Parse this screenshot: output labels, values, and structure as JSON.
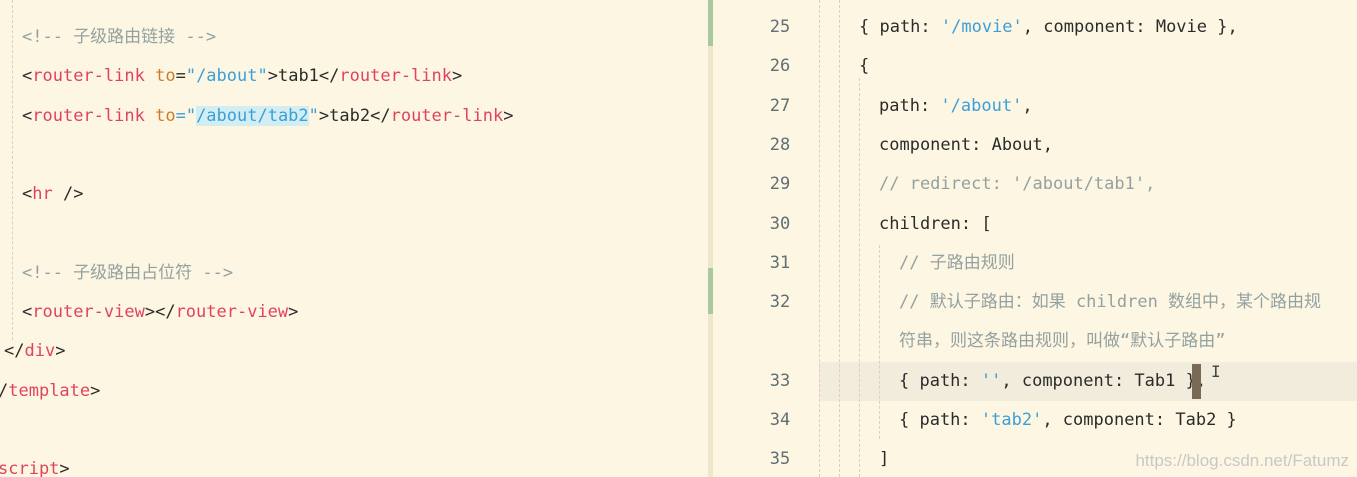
{
  "left_editor": {
    "lines": [
      [
        {
          "t": "<!-- 子级路由链接 -->",
          "c": "cmt"
        }
      ],
      [
        {
          "t": "<",
          "c": "pun"
        },
        {
          "t": "router-link",
          "c": "tag"
        },
        {
          "t": " ",
          "c": "pun"
        },
        {
          "t": "to",
          "c": "attr"
        },
        {
          "t": "=",
          "c": "pun"
        },
        {
          "t": "\"/about\"",
          "c": "str"
        },
        {
          "t": ">",
          "c": "pun"
        },
        {
          "t": "tab1",
          "c": "txt"
        },
        {
          "t": "</",
          "c": "pun"
        },
        {
          "t": "router-link",
          "c": "tag"
        },
        {
          "t": ">",
          "c": "pun"
        }
      ],
      [
        {
          "t": "<",
          "c": "pun"
        },
        {
          "t": "router-link",
          "c": "tag"
        },
        {
          "t": " ",
          "c": "pun"
        },
        {
          "t": "to",
          "c": "attr"
        },
        {
          "t": "=\"",
          "c": "str"
        },
        {
          "t": "/about/tab2",
          "c": "str",
          "hl": true
        },
        {
          "t": "\"",
          "c": "str"
        },
        {
          "t": ">",
          "c": "pun"
        },
        {
          "t": "tab2",
          "c": "txt"
        },
        {
          "t": "</",
          "c": "pun"
        },
        {
          "t": "router-link",
          "c": "tag"
        },
        {
          "t": ">",
          "c": "pun"
        }
      ],
      [],
      [
        {
          "t": "<",
          "c": "pun"
        },
        {
          "t": "hr",
          "c": "tag"
        },
        {
          "t": " />",
          "c": "pun"
        }
      ],
      [],
      [
        {
          "t": "<!-- 子级路由占位符 -->",
          "c": "cmt"
        }
      ],
      [
        {
          "t": "<",
          "c": "pun"
        },
        {
          "t": "router-view",
          "c": "tag"
        },
        {
          "t": "></",
          "c": "pun"
        },
        {
          "t": "router-view",
          "c": "tag"
        },
        {
          "t": ">",
          "c": "pun"
        }
      ],
      [
        {
          "t": "</",
          "c": "pun"
        },
        {
          "t": "div",
          "c": "tag"
        },
        {
          "t": ">",
          "c": "pun"
        }
      ],
      [
        {
          "t": "/",
          "c": "pun"
        },
        {
          "t": "template",
          "c": "tag"
        },
        {
          "t": ">",
          "c": "pun"
        }
      ],
      [],
      [
        {
          "t": "script",
          "c": "tag"
        },
        {
          "t": ">",
          "c": "pun"
        }
      ]
    ]
  },
  "right_editor": {
    "lines": [
      {
        "num": "25",
        "tokens": [
          {
            "t": "{ path: ",
            "c": "txt"
          },
          {
            "t": "'/movie'",
            "c": "str"
          },
          {
            "t": ", component: Movie },",
            "c": "txt"
          }
        ]
      },
      {
        "num": "26",
        "tokens": [
          {
            "t": "{",
            "c": "txt"
          }
        ]
      },
      {
        "num": "27",
        "tokens": [
          {
            "t": "path: ",
            "c": "txt"
          },
          {
            "t": "'/about'",
            "c": "str"
          },
          {
            "t": ",",
            "c": "txt"
          }
        ]
      },
      {
        "num": "28",
        "tokens": [
          {
            "t": "component: About,",
            "c": "txt"
          }
        ]
      },
      {
        "num": "29",
        "tokens": [
          {
            "t": "// redirect: '/about/tab1',",
            "c": "cmt"
          }
        ]
      },
      {
        "num": "30",
        "tokens": [
          {
            "t": "children: [",
            "c": "txt"
          }
        ]
      },
      {
        "num": "31",
        "tokens": [
          {
            "t": "// 子路由规则",
            "c": "cmt"
          }
        ]
      },
      {
        "num": "32",
        "tokens": [
          {
            "t": "// 默认子路由：如果 children 数组中，某个路由规",
            "c": "cmt"
          }
        ]
      },
      {
        "num": "",
        "tokens": [
          {
            "t": "符串，则这条路由规则，叫做“默认子路由”",
            "c": "cmt"
          }
        ]
      },
      {
        "num": "33",
        "tokens": [
          {
            "t": "{ path: ",
            "c": "txt"
          },
          {
            "t": "''",
            "c": "str"
          },
          {
            "t": ", component: Tab1 },",
            "c": "txt"
          }
        ]
      },
      {
        "num": "34",
        "tokens": [
          {
            "t": "{ path: ",
            "c": "txt"
          },
          {
            "t": "'tab2'",
            "c": "str"
          },
          {
            "t": ", component: Tab2 }",
            "c": "txt"
          }
        ]
      },
      {
        "num": "35",
        "tokens": [
          {
            "t": "]",
            "c": "txt"
          }
        ]
      }
    ]
  },
  "watermark": "https://blog.csdn.net/Fatumz",
  "ibeam_glyph": "I"
}
